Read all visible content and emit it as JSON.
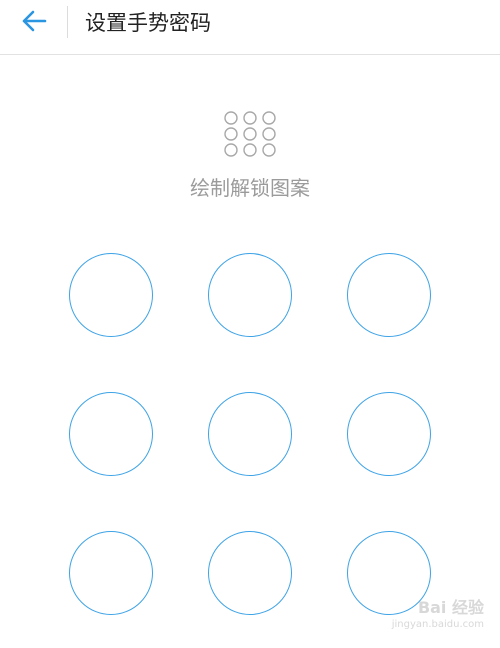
{
  "header": {
    "back_icon": "arrow-left-icon",
    "title": "设置手势密码"
  },
  "hint": {
    "icon": "nine-dot-grid-icon",
    "text": "绘制解锁图案"
  },
  "pattern": {
    "rows": 3,
    "cols": 3
  },
  "watermark": {
    "brand": "Bai 经验",
    "url": "jingyan.baidu.com"
  },
  "colors": {
    "accent": "#3ea3e6",
    "hint_text": "#9b9b9b",
    "title_text": "#222222"
  }
}
